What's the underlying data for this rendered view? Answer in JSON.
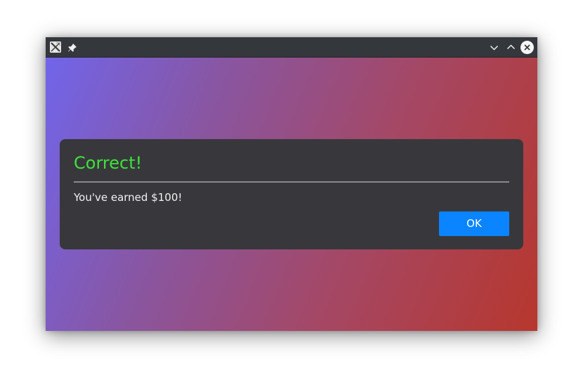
{
  "titlebar": {
    "app_icon": "app-icon",
    "pin_icon": "pin-icon",
    "minimize_icon": "chevron-down-icon",
    "maximize_icon": "chevron-up-icon",
    "close_icon": "close-icon"
  },
  "dialog": {
    "title": "Correct!",
    "message": "You've earned $100!",
    "ok_label": "OK"
  },
  "colors": {
    "title_green": "#3ee23a",
    "button_blue": "#0a84ff",
    "dialog_bg": "#38383c",
    "gradient_start": "#7165ea",
    "gradient_end": "#b7372d"
  }
}
